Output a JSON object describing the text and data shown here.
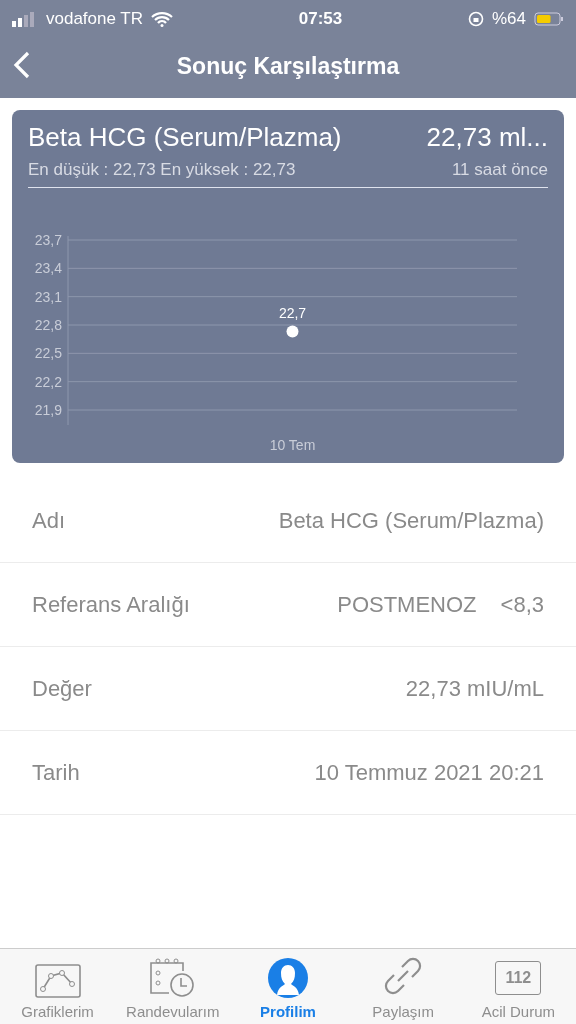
{
  "status_bar": {
    "carrier": "vodafone TR",
    "time": "07:53",
    "battery_text": "%64"
  },
  "nav": {
    "title": "Sonuç Karşılaştırma"
  },
  "card": {
    "title": "Beta HCG (Serum/Plazma)",
    "value": "22,73 ml...",
    "range_text": "En düşük : 22,73 En yüksek : 22,73",
    "time_ago": "11 saat önce",
    "chart_data": {
      "type": "scatter",
      "grid": true,
      "categories": [
        "10 Tem"
      ],
      "series": [
        {
          "color": "#ffffff",
          "values": [
            22.73
          ]
        }
      ],
      "ylim": [
        21.9,
        23.7
      ],
      "yticks": [
        {
          "value": 21.9,
          "label": "21,9"
        },
        {
          "value": 22.2,
          "label": "22,2"
        },
        {
          "value": 22.5,
          "label": "22,5"
        },
        {
          "value": 22.8,
          "label": "22,8"
        },
        {
          "value": 23.1,
          "label": "23,1"
        },
        {
          "value": 23.4,
          "label": "23,4"
        },
        {
          "value": 23.7,
          "label": "23,7"
        }
      ],
      "value_labels": [
        "22,7"
      ]
    }
  },
  "details": [
    {
      "label": "Adı",
      "values": [
        "Beta HCG (Serum/Plazma)"
      ]
    },
    {
      "label": "Referans Aralığı",
      "values": [
        "POSTMENOZ",
        "<8,3"
      ]
    },
    {
      "label": "Değer",
      "values": [
        "22,73 mIU/mL"
      ]
    },
    {
      "label": "Tarih",
      "values": [
        "10 Temmuz 2021 20:21"
      ]
    }
  ],
  "tabs": [
    {
      "label": "Grafiklerim",
      "kind": "chart",
      "selected": false
    },
    {
      "label": "Randevularım",
      "kind": "calendar",
      "selected": false
    },
    {
      "label": "Profilim",
      "kind": "profile",
      "selected": true
    },
    {
      "label": "Paylaşım",
      "kind": "link",
      "selected": false
    },
    {
      "label": "Acil Durum",
      "kind": "emergency",
      "icon_text": "112",
      "selected": false
    }
  ]
}
